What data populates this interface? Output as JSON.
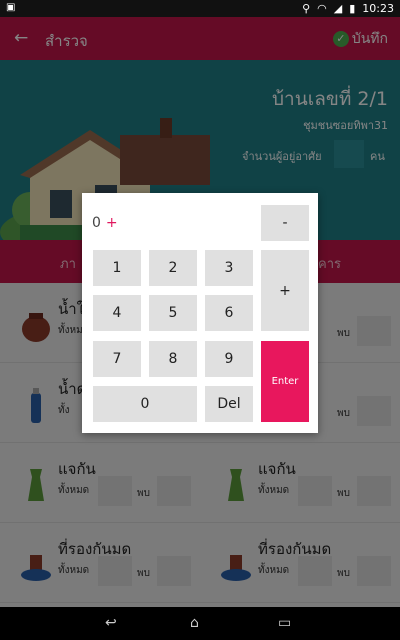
{
  "status_bar": {
    "time": "10:23",
    "app_icon": "notification-icon"
  },
  "app_bar": {
    "back_icon": "arrow-left-icon",
    "title": "สำรวจ",
    "save_label": "บันทึก"
  },
  "header": {
    "house_number": "บ้านเลขที่  2/1",
    "community": "ชุมชนซอยทิพา31",
    "residents_label": "จำนวนผู้อยู่อาศัย",
    "residents_unit": "คน"
  },
  "tabs": [
    "ภา",
    "คาร"
  ],
  "items": [
    {
      "name": "น้ำใ",
      "total_label": "ทั้งหมด",
      "found_label": "พบ"
    },
    {
      "name": "",
      "total_label": "",
      "found_label": "พบ"
    },
    {
      "name": "น้ำด",
      "total_label": "ทั้ง",
      "found_label": ""
    },
    {
      "name": "",
      "total_label": "",
      "found_label": "พบ"
    },
    {
      "name": "แจกัน",
      "total_label": "ทั้งหมด",
      "found_label": "พบ"
    },
    {
      "name": "แจกัน",
      "total_label": "ทั้งหมด",
      "found_label": "พบ"
    },
    {
      "name": "ที่รองกันมด",
      "total_label": "ทั้งหมด",
      "found_label": "พบ"
    },
    {
      "name": "ที่รองกันมด",
      "total_label": "ทั้งหมด",
      "found_label": "พบ"
    }
  ],
  "calculator": {
    "display_value": "0",
    "display_operator": "+",
    "keys": {
      "minus": "-",
      "plus": "+",
      "enter": "Enter",
      "k1": "1",
      "k2": "2",
      "k3": "3",
      "k4": "4",
      "k5": "5",
      "k6": "6",
      "k7": "7",
      "k8": "8",
      "k9": "9",
      "k0": "0",
      "del": "Del"
    }
  },
  "colors": {
    "primary": "#c1164a",
    "enter": "#e8175d",
    "banner": "#1f7f86"
  }
}
